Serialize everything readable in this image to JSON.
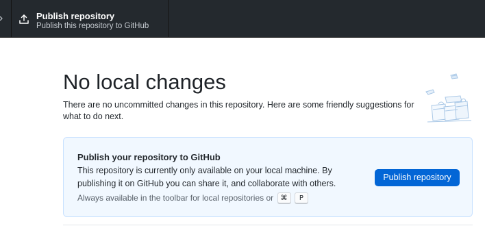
{
  "toolbar": {
    "publish_button": {
      "title": "Publish repository",
      "subtitle": "Publish this repository to GitHub",
      "icon": "upload-icon"
    }
  },
  "main": {
    "heading": "No local changes",
    "intro": "There are no uncommitted changes in this repository. Here are some friendly suggestions for what to do next.",
    "illustration": "empty-state-illustration"
  },
  "card": {
    "title": "Publish your repository to GitHub",
    "description": "This repository is currently only available on your local machine. By publishing it on GitHub you can share it, and collaborate with others.",
    "hint": "Always available in the toolbar for local repositories or",
    "shortcut_keys": [
      "⌘",
      "P"
    ],
    "button_label": "Publish repository"
  },
  "colors": {
    "toolbar_bg": "#24292e",
    "accent": "#0366d6",
    "card_bg": "#f1f8ff",
    "card_border": "#c8e1ff"
  }
}
